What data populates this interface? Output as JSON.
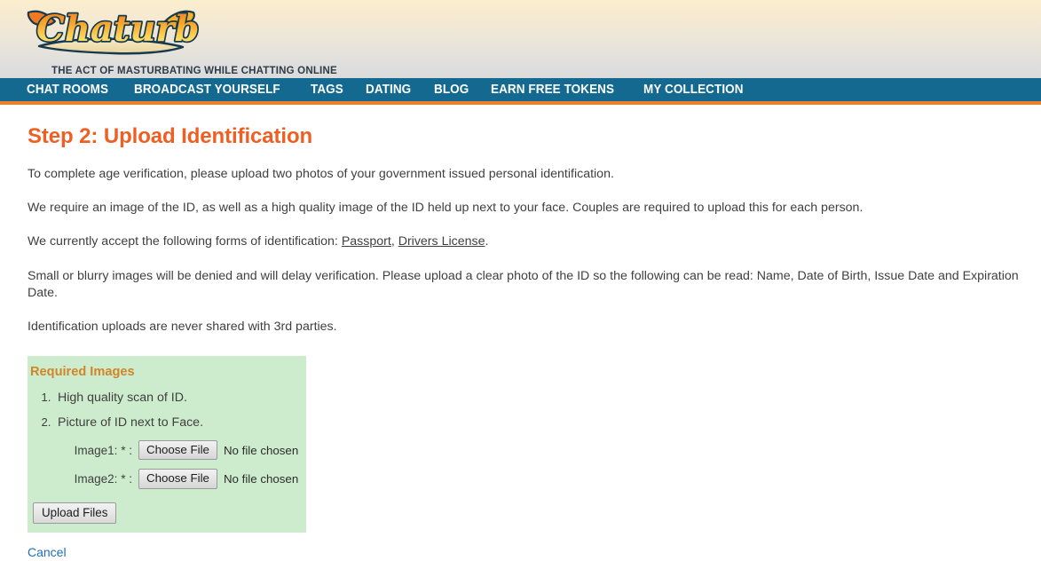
{
  "header": {
    "logo_text": "Chaturbate",
    "logo_icon": "chaturbate-script-logo",
    "tagline": "THE ACT OF MASTURBATING WHILE CHATTING ONLINE"
  },
  "nav": {
    "items": [
      {
        "label": "CHAT ROOMS"
      },
      {
        "label": "BROADCAST YOURSELF"
      },
      {
        "label": "TAGS"
      },
      {
        "label": "DATING"
      },
      {
        "label": "BLOG"
      },
      {
        "label": "EARN FREE TOKENS"
      },
      {
        "label": "MY COLLECTION"
      }
    ]
  },
  "main": {
    "title": "Step 2: Upload Identification",
    "p1": "To complete age verification, please upload two photos of your government issued personal identification.",
    "p2": "We require an image of the ID, as well as a high quality image of the ID held up next to your face. Couples are required to upload this for each person.",
    "p3_prefix": "We currently accept the following forms of identification: ",
    "p3_link1": "Passport",
    "p3_sep": ", ",
    "p3_link2": "Drivers License",
    "p3_suffix": ".",
    "p4": "Small or blurry images will be denied and will delay verification. Please upload a clear photo of the ID so the following can be read: Name, Date of Birth, Issue Date and Expiration Date.",
    "p5": "Identification uploads are never shared with 3rd parties."
  },
  "required_box": {
    "title": "Required Images",
    "items": [
      "High quality scan of ID.",
      "Picture of ID next to Face."
    ],
    "fields": [
      {
        "label": "Image1:",
        "required_marker": "*",
        "colon": ":",
        "button_label": "Choose File",
        "file_status": "No file chosen"
      },
      {
        "label": "Image2:",
        "required_marker": "*",
        "colon": ":",
        "button_label": "Choose File",
        "file_status": "No file chosen"
      }
    ],
    "submit_label": "Upload Files"
  },
  "footer": {
    "cancel_label": "Cancel"
  },
  "colors": {
    "nav_background": "#13698f",
    "nav_accent": "#f07f2d",
    "heading": "#ef5f24",
    "panel_background": "#cdeccd",
    "panel_title": "#d08528",
    "link": "#1f6fb4",
    "header_gradient_top": "#fbeecd",
    "header_gradient_bottom": "#dcdcdc"
  }
}
